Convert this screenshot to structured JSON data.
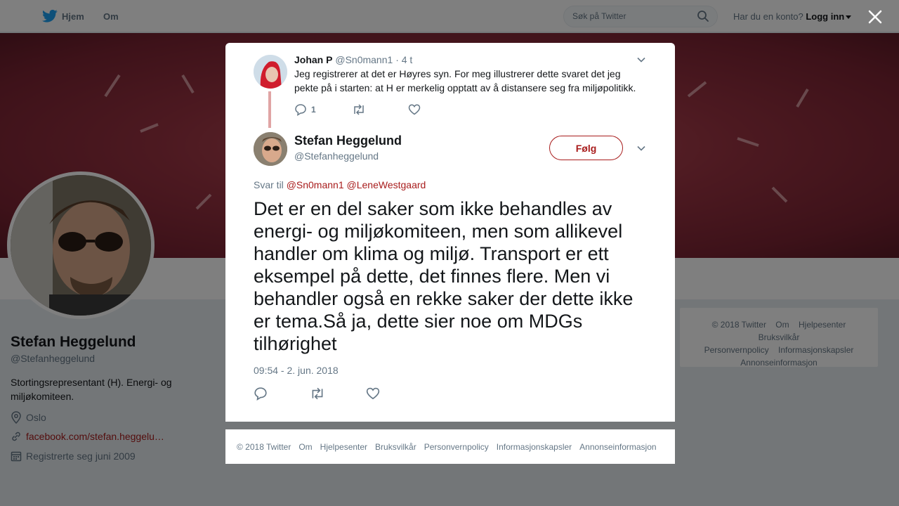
{
  "nav": {
    "home": "Hjem",
    "about": "Om",
    "search_placeholder": "Søk på Twitter",
    "account_prompt": "Har du en konto?",
    "login": "Logg inn"
  },
  "profile": {
    "name": "Stefan Heggelund",
    "handle": "@Stefanheggelund",
    "bio": "Stortingsrepresentant (H). Energi- og miljøkomiteen.",
    "location": "Oslo",
    "link": "facebook.com/stefan.heggelu…",
    "joined": "Registrerte seg juni 2009"
  },
  "side_footer": [
    "© 2018 Twitter",
    "Om",
    "Hjelpesenter",
    "Bruksvilkår",
    "Personvernpolicy",
    "Informasjonskapsler",
    "Annonseinformasjon"
  ],
  "reply": {
    "name": "Johan P",
    "handle": "@Sn0mann1",
    "time": "· 4 t",
    "text": "Jeg registrerer at det er Høyres syn. For meg illustrerer dette svaret det jeg pekte på i starten: at H er merkelig opptatt av å distansere seg fra miljøpolitikk.",
    "reply_count": "1"
  },
  "tweet": {
    "name": "Stefan Heggelund",
    "handle": "@Stefanheggelund",
    "follow": "Følg",
    "reply_to_label": "Svar til",
    "mention1": "@Sn0mann1",
    "mention2": "@LeneWestgaard",
    "text": "Det er en del saker som ikke behandles av energi- og miljøkomiteen, men som allikevel handler om klima og miljø. Transport er ett eksempel på dette, det finnes flere. Men vi behandler også en rekke saker der dette ikke er tema.Så ja, dette sier noe om MDGs tilhørighet",
    "timestamp": "09:54 - 2. jun. 2018"
  },
  "modal_footer": [
    "© 2018 Twitter",
    "Om",
    "Hjelpesenter",
    "Bruksvilkår",
    "Personvernpolicy",
    "Informasjonskapsler",
    "Annonseinformasjon"
  ],
  "colors": {
    "accent": "#a81c1c",
    "twitter_blue": "#1da1f2",
    "muted": "#657786"
  }
}
